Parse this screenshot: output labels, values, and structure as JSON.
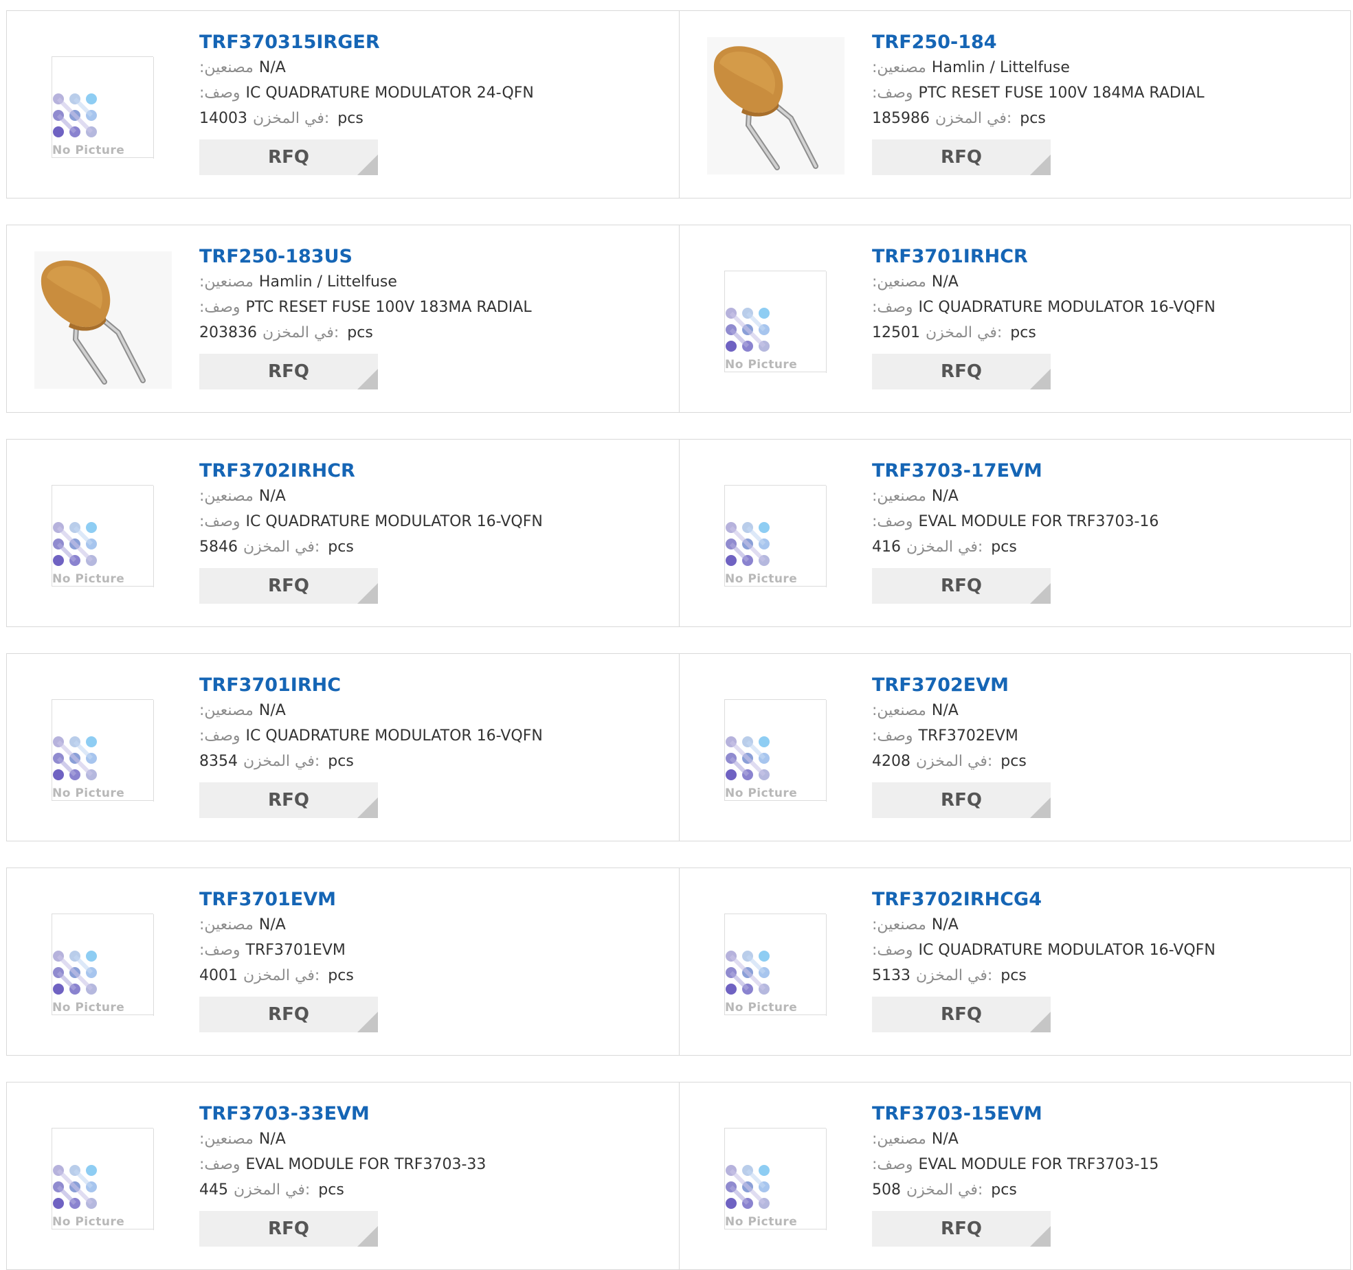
{
  "labels": {
    "manufacturer": ":مصنعين",
    "description": ":وصف",
    "stock": ":في المخزن",
    "unit": "pcs",
    "rfq": "RFQ",
    "no_picture": "No Picture"
  },
  "rows": [
    [
      {
        "part": "TRF370315IRGER",
        "manufacturer": "N/A",
        "description": "IC QUADRATURE MODULATOR 24-QFN",
        "stock": "14003",
        "image": "no-picture"
      },
      {
        "part": "TRF250-184",
        "manufacturer": "Hamlin / Littelfuse",
        "description": "PTC RESET FUSE 100V 184MA RADIAL",
        "stock": "185986",
        "image": "ptc-fuse"
      }
    ],
    [
      {
        "part": "TRF250-183US",
        "manufacturer": "Hamlin / Littelfuse",
        "description": "PTC RESET FUSE 100V 183MA RADIAL",
        "stock": "203836",
        "image": "ptc-fuse"
      },
      {
        "part": "TRF3701IRHCR",
        "manufacturer": "N/A",
        "description": "IC QUADRATURE MODULATOR 16-VQFN",
        "stock": "12501",
        "image": "no-picture"
      }
    ],
    [
      {
        "part": "TRF3702IRHCR",
        "manufacturer": "N/A",
        "description": "IC QUADRATURE MODULATOR 16-VQFN",
        "stock": "5846",
        "image": "no-picture"
      },
      {
        "part": "TRF3703-17EVM",
        "manufacturer": "N/A",
        "description": "EVAL MODULE FOR TRF3703-16",
        "stock": "416",
        "image": "no-picture"
      }
    ],
    [
      {
        "part": "TRF3701IRHC",
        "manufacturer": "N/A",
        "description": "IC QUADRATURE MODULATOR 16-VQFN",
        "stock": "8354",
        "image": "no-picture"
      },
      {
        "part": "TRF3702EVM",
        "manufacturer": "N/A",
        "description": "TRF3702EVM",
        "stock": "4208",
        "image": "no-picture"
      }
    ],
    [
      {
        "part": "TRF3701EVM",
        "manufacturer": "N/A",
        "description": "TRF3701EVM",
        "stock": "4001",
        "image": "no-picture"
      },
      {
        "part": "TRF3702IRHCG4",
        "manufacturer": "N/A",
        "description": "IC QUADRATURE MODULATOR 16-VQFN",
        "stock": "5133",
        "image": "no-picture"
      }
    ],
    [
      {
        "part": "TRF3703-33EVM",
        "manufacturer": "N/A",
        "description": "EVAL MODULE FOR TRF3703-33",
        "stock": "445",
        "image": "no-picture"
      },
      {
        "part": "TRF3703-15EVM",
        "manufacturer": "N/A",
        "description": "EVAL MODULE FOR TRF3703-15",
        "stock": "508",
        "image": "no-picture"
      }
    ]
  ],
  "colors": {
    "title": "#1565b5",
    "label": "#8c8c8c",
    "border": "#d9d9d9",
    "button_bg": "#efefef",
    "button_corner": "#c6c6c6"
  }
}
